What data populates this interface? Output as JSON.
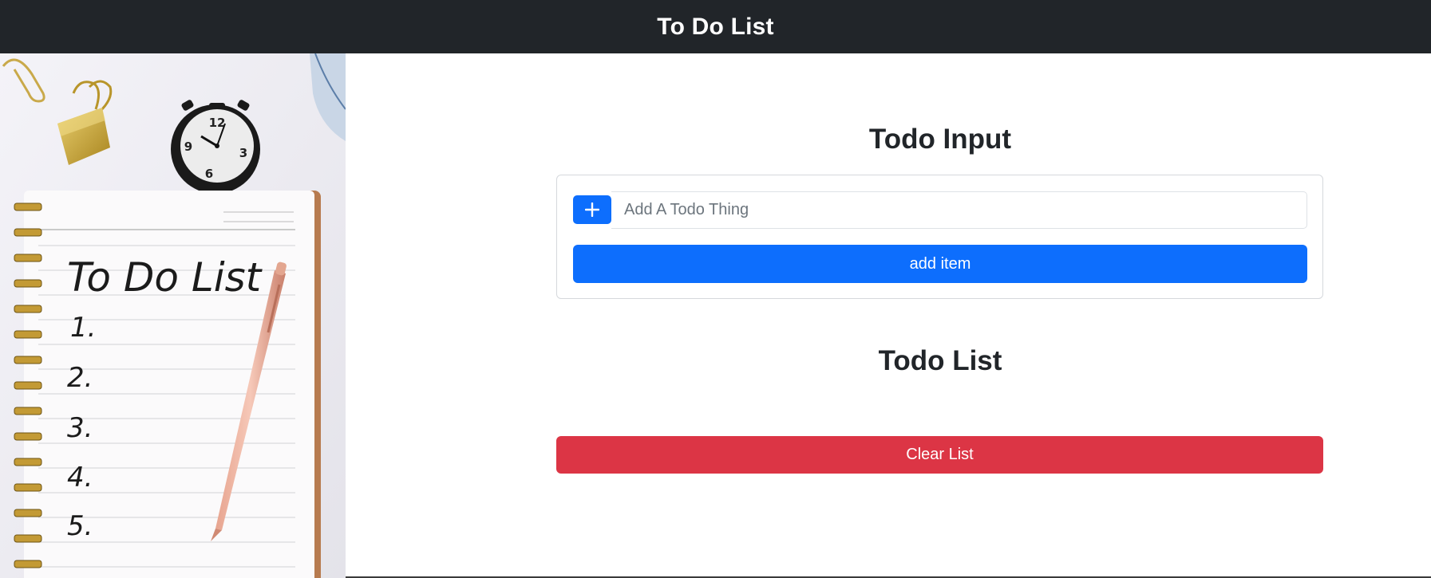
{
  "navbar": {
    "title": "To Do List"
  },
  "hero": {
    "image_alt": "notebook with To Do List",
    "notebook_heading": "To Do List",
    "list_numbers": [
      "1.",
      "2.",
      "3.",
      "4.",
      "5."
    ],
    "clock_numbers": [
      "12",
      "9",
      "3",
      "6"
    ]
  },
  "input_section": {
    "title": "Todo Input",
    "plus_icon": "plus-icon",
    "input_placeholder": "Add A Todo Thing",
    "input_value": "",
    "add_button_label": "add item"
  },
  "list_section": {
    "title": "Todo List",
    "items": [],
    "clear_button_label": "Clear List"
  },
  "colors": {
    "navbar_bg": "#212529",
    "primary": "#0d6efd",
    "danger": "#dc3545"
  }
}
